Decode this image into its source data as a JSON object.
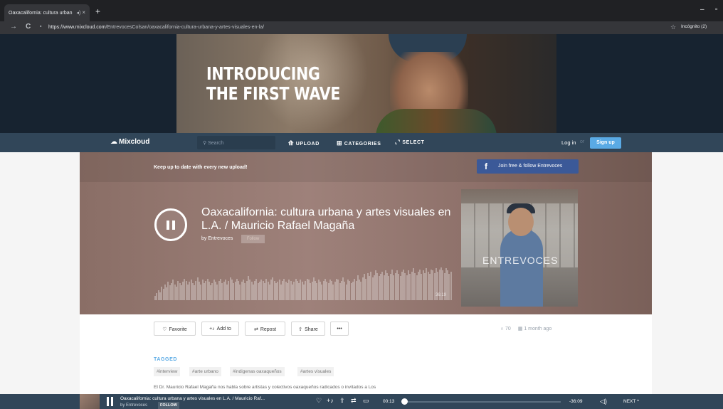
{
  "browser": {
    "tab_title": "Oaxacalifornia: cultura urban",
    "tab_close": "×",
    "new_tab": "+",
    "minimize": "–",
    "restore": "▫",
    "back": "→",
    "reload": "C",
    "url_host": "https://www.mixcloud.com",
    "url_path": "/EntrevocesColsan/oaxacalifornia-cultura-urbana-y-artes-visuales-en-la/",
    "profile": "Incógnito (2)"
  },
  "banner": {
    "line1": "INTRODUCING",
    "line2": "THE FIRST WAVE"
  },
  "nav": {
    "logo": "Mixcloud",
    "search_placeholder": "Search",
    "upload": "UPLOAD",
    "categories": "CATEGORIES",
    "select": "SELECT",
    "login": "Log in",
    "separator": "or",
    "signup": "Sign up"
  },
  "cast": {
    "keep_up": "Keep up to date with every new upload!",
    "fb_join": "Join free & follow Entrevoces",
    "title": "Oaxacalifornia: cultura urbana y artes visuales en L.A. / Mauricio Rafael Magaña",
    "by": "by Entrevoces",
    "follow": "Follow",
    "duration": "36:19",
    "cover_text": "ENTREVOCES",
    "waveform": [
      4,
      6,
      9,
      7,
      12,
      10,
      14,
      11,
      16,
      13,
      15,
      18,
      14,
      12,
      17,
      15,
      13,
      16,
      19,
      17,
      14,
      16,
      18,
      15,
      13,
      17,
      20,
      16,
      14,
      18,
      15,
      17,
      19,
      16,
      13,
      15,
      18,
      16,
      14,
      17,
      19,
      15,
      16,
      18,
      14,
      17,
      20,
      18,
      15,
      16,
      19,
      17,
      14,
      16,
      18,
      15,
      17,
      21,
      18,
      16,
      14,
      17,
      19,
      15,
      16,
      18,
      17,
      15,
      19,
      16,
      14,
      18,
      20,
      17,
      15,
      16,
      18,
      14,
      17,
      19,
      16,
      15,
      18,
      17,
      14,
      16,
      19,
      17,
      15,
      18,
      16,
      14,
      17,
      19,
      18,
      15,
      16,
      20,
      17,
      15,
      18,
      16,
      14,
      17,
      19,
      16,
      15,
      18,
      17,
      14,
      16,
      19,
      18,
      15,
      17,
      20,
      16,
      14,
      18,
      17,
      15,
      16,
      19,
      17,
      22,
      18,
      16,
      20,
      23,
      19,
      24,
      21,
      25,
      20,
      22,
      26,
      24,
      21,
      23,
      25,
      22,
      26,
      24,
      21,
      23,
      27,
      22,
      24,
      26,
      23,
      21,
      25,
      27,
      24,
      22,
      26,
      23,
      25,
      28,
      24,
      22,
      25,
      27,
      23,
      26,
      24,
      28,
      25,
      23,
      27,
      26,
      24,
      28,
      25,
      27,
      29,
      26,
      24,
      28,
      26,
      23,
      25
    ]
  },
  "actions": {
    "favorite": "Favorite",
    "add_to": "Add to",
    "repost": "Repost",
    "share": "Share",
    "more": "•••",
    "plays": "70",
    "date": "1 month ago"
  },
  "tags": {
    "heading": "TAGGED",
    "items": [
      "#interview",
      "#arte urbano",
      "#indigenas oaxaqueños",
      "#artes visuales"
    ]
  },
  "description": "El Dr. Mauricio Rafael Magaña nos habla sobre artistas y colectivos oaxaqueños radicados o invitados a Los",
  "player": {
    "title": "Oaxacalifornia: cultura urbana y artes visuales en L.A. / Mauricio Raf...",
    "by": "by Entrevoces",
    "follow": "FOLLOW",
    "elapsed": "00:13",
    "remaining": "-36:09",
    "next": "NEXT ^",
    "progress": 0.006
  }
}
